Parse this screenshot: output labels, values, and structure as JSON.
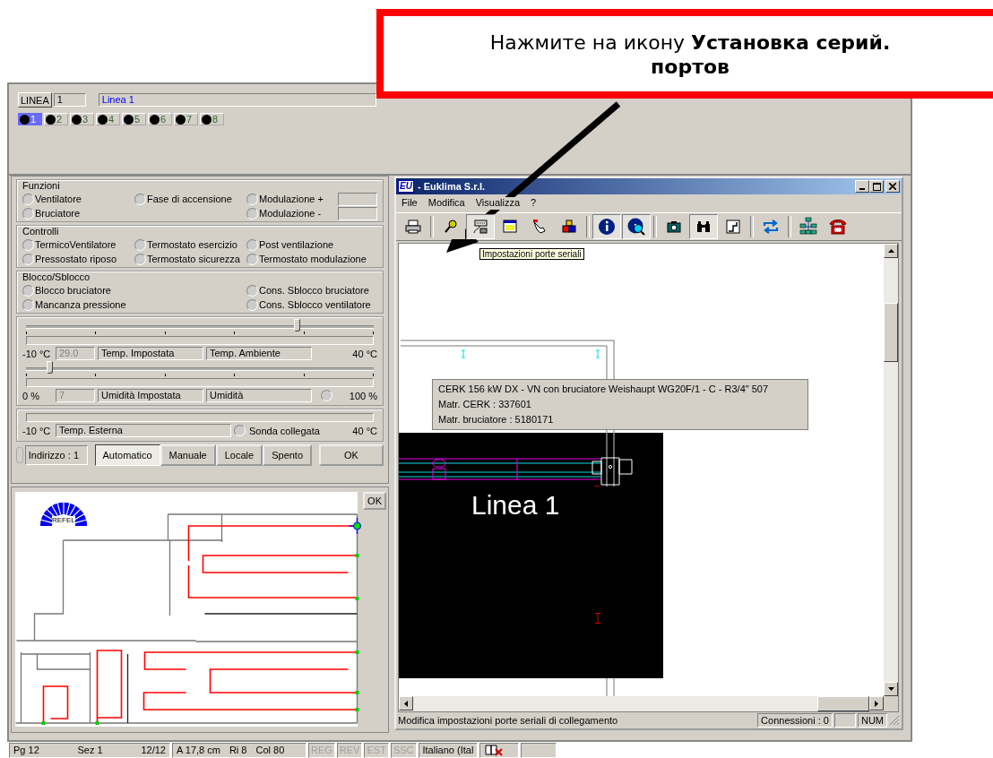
{
  "callout": {
    "text": "Нажмите на икону **Установка серий. портов**"
  },
  "line_bar": {
    "button": "LINEA",
    "number": "1",
    "name": "Linea 1",
    "lines": [
      {
        "label": "1",
        "selected": true
      },
      {
        "label": "2",
        "selected": false
      },
      {
        "label": "3",
        "selected": false
      },
      {
        "label": "4",
        "selected": false
      },
      {
        "label": "5",
        "selected": false
      },
      {
        "label": "6",
        "selected": false
      },
      {
        "label": "7",
        "selected": false
      },
      {
        "label": "8",
        "selected": false
      }
    ]
  },
  "groups": [
    {
      "title": "Funzioni",
      "rows": [
        [
          {
            "label": "Ventilatore",
            "checked": false,
            "kind": "radio"
          },
          {
            "label": "Fase di accensione",
            "checked": false,
            "kind": "radio"
          },
          {
            "label": "Modulazione +",
            "checked": false,
            "kind": "radio_field"
          }
        ],
        [
          {
            "label": "Bruciatore",
            "checked": false,
            "kind": "radio"
          },
          null,
          {
            "label": "Modulazione -",
            "checked": false,
            "kind": "radio_field"
          }
        ]
      ]
    },
    {
      "title": "Controlli",
      "rows": [
        [
          {
            "label": "TermicoVentilatore",
            "checked": false,
            "kind": "radio"
          },
          {
            "label": "Termostato esercizio",
            "checked": false,
            "kind": "radio"
          },
          {
            "label": "Post ventilazione",
            "checked": false,
            "kind": "radio"
          }
        ],
        [
          {
            "label": "Pressostato riposo",
            "checked": false,
            "kind": "radio"
          },
          {
            "label": "Termostato sicurezza",
            "checked": false,
            "kind": "radio"
          },
          {
            "label": "Termostato modulazione",
            "checked": false,
            "kind": "radio"
          }
        ]
      ]
    },
    {
      "title": "Blocco/Sblocco",
      "rows": [
        [
          {
            "label": "Blocco bruciatore",
            "checked": false,
            "kind": "radio"
          },
          null,
          {
            "label": "Cons. Sblocco bruciatore",
            "checked": false,
            "kind": "radio"
          }
        ],
        [
          {
            "label": "Mancanza pressione",
            "checked": false,
            "kind": "radio"
          },
          null,
          {
            "label": "Cons. Sblocco ventilatore",
            "checked": false,
            "kind": "radio"
          }
        ]
      ]
    }
  ],
  "sliders": [
    {
      "level": 0.78,
      "min": "-10 °C",
      "value": "29.0",
      "set_label": "Temp. Impostata",
      "measured_label": "Temp. Ambiente",
      "max": "40 °C"
    },
    {
      "level": 0.07,
      "min": "0 %",
      "value": "7",
      "set_label": "Umidità Impostata",
      "measured_label": "Umidità",
      "indicator": {
        "checked": false
      },
      "max": "100 %"
    }
  ],
  "external": {
    "min": "-10 °C",
    "label": "Temp. Esterna",
    "probe": {
      "label": "Sonda collegata",
      "checked": false
    },
    "max": "40 °C"
  },
  "controls": {
    "address": "Indirizzo : 1",
    "modes": [
      {
        "label": "Automatico",
        "selected": true
      },
      {
        "label": "Manuale",
        "selected": false
      },
      {
        "label": "Locale",
        "selected": false
      },
      {
        "label": "Spento",
        "selected": false
      }
    ],
    "ok": "OK"
  },
  "plan": {
    "ok": "OK",
    "logo": "REFEL"
  },
  "status_bar": {
    "page": "Pg 12",
    "section": "Sez 1",
    "pages": "12/12",
    "position": "A 17,8 cm",
    "line": "Ri 8",
    "column": "Col 80",
    "indicators": [
      {
        "label": "REG",
        "enabled": false
      },
      {
        "label": "REV",
        "enabled": false
      },
      {
        "label": "EST",
        "enabled": false
      },
      {
        "label": "SSC",
        "enabled": false
      }
    ],
    "language": "Italiano (Ital"
  },
  "euklima": {
    "logo": "EU",
    "title": "- Euklima S.r.l.",
    "menu": [
      "File",
      "Modifica",
      "Visualizza",
      "?"
    ],
    "toolbar": [
      [
        {
          "kind": "printer",
          "pressed": false
        }
      ],
      [
        {
          "kind": "key",
          "pressed": false
        },
        {
          "kind": "serial",
          "pressed": true
        },
        {
          "kind": "window",
          "pressed": false
        },
        {
          "kind": "hand",
          "pressed": false
        },
        {
          "kind": "cubes",
          "pressed": false
        }
      ],
      [
        {
          "kind": "info",
          "pressed": true
        },
        {
          "kind": "info_search",
          "pressed": true
        }
      ],
      [
        {
          "kind": "camera",
          "pressed": false
        },
        {
          "kind": "binoculars",
          "pressed": true
        },
        {
          "kind": "chart",
          "pressed": false
        }
      ],
      [
        {
          "kind": "arrows",
          "pressed": false
        }
      ],
      [
        {
          "kind": "network",
          "pressed": false
        },
        {
          "kind": "phone",
          "pressed": false
        }
      ]
    ],
    "tooltip": "Impostazioni porte seriali",
    "info_lines": [
      "CERK 156 kW DX - VN con bruciatore Weishaupt WG20F/1 - C - R3/4\" 507",
      "Matr. CERK : 337601",
      "Matr. bruciatore : 5180171"
    ],
    "plan_title": "Linea 1",
    "status": "Modifica impostazioni porte seriali di collegamento",
    "connections": "Connessioni : 0",
    "num": "NUM"
  }
}
